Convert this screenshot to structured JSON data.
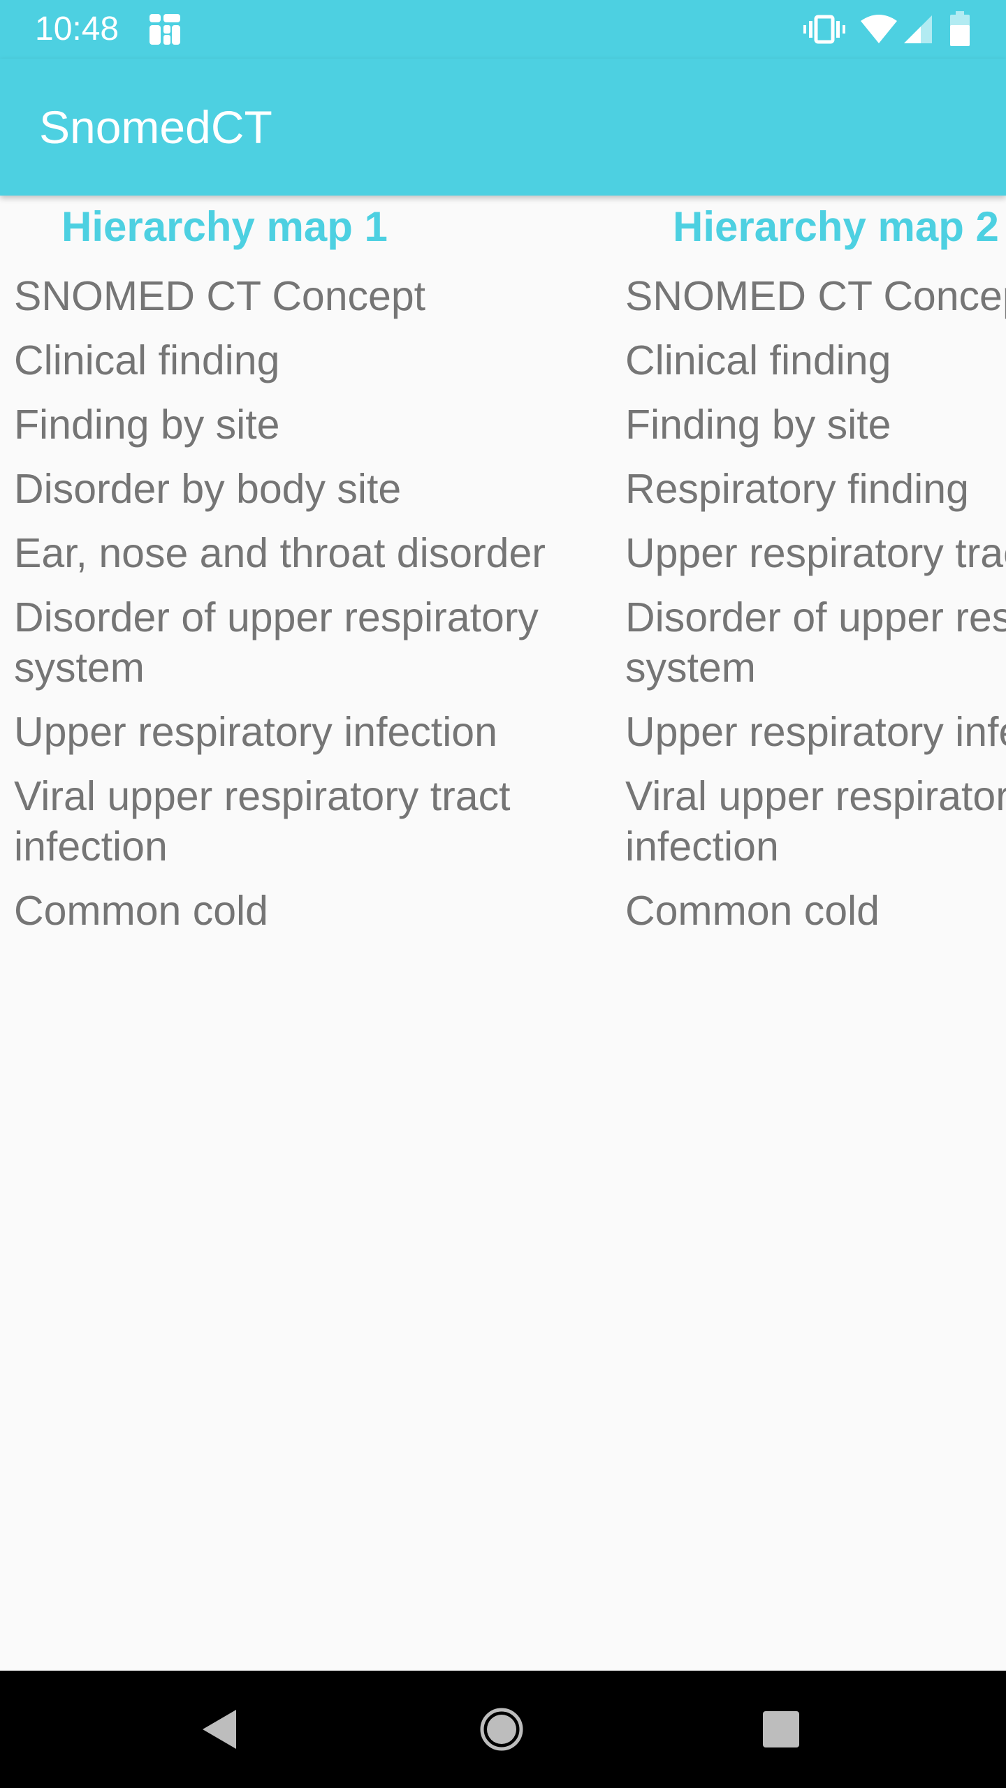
{
  "status_bar": {
    "time": "10:48",
    "icons": [
      "app-notification-icon",
      "vibrate-icon",
      "wifi-icon",
      "cell-signal-icon",
      "battery-icon"
    ]
  },
  "app_bar": {
    "title": "SnomedCT"
  },
  "colors": {
    "primary": "#4dd0e1",
    "text": "#757575",
    "background": "#fafafa"
  },
  "maps": [
    {
      "title": "Hierarchy map 1",
      "items": [
        "SNOMED CT Concept",
        "Clinical finding",
        "Finding by site",
        "Disorder by body site",
        "Ear, nose and throat disorder",
        "Disorder of upper respiratory system",
        "Upper respiratory infection",
        "Viral upper respiratory tract infection",
        "Common cold"
      ]
    },
    {
      "title": "Hierarchy map 2",
      "items": [
        "SNOMED CT Concept",
        "Clinical finding",
        "Finding by site",
        "Respiratory finding",
        "Upper respiratory tract",
        "Disorder of upper respiratory system",
        "Upper respiratory infection",
        "Viral upper respiratory tract infection",
        "Common cold"
      ]
    }
  ],
  "nav_bar": {
    "icons": [
      "back-icon",
      "home-icon",
      "recents-icon"
    ]
  }
}
